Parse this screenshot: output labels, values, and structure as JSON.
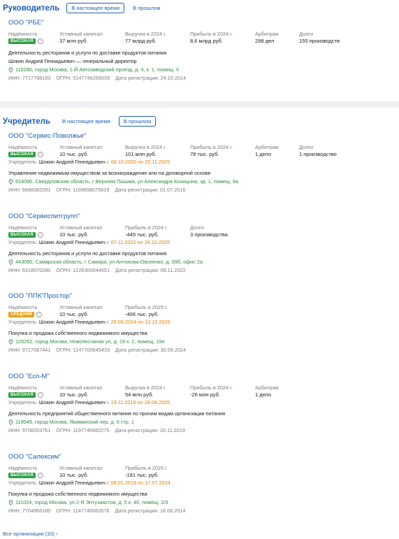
{
  "leader": {
    "title": "Руководитель",
    "tab_present": "В настоящее время",
    "tab_past": "В прошлом",
    "org": {
      "name": "ООО \"РБЕ\"",
      "labels": [
        "Надёжность",
        "Уставный капитал",
        "Выручка в 2024 г.",
        "Прибыль в 2024 г.",
        "Арбитраж",
        "Долги"
      ],
      "badge": "ВЫСОКАЯ",
      "values": [
        "37 млн руб.",
        "77 млрд руб.",
        "8,6 млрд руб.",
        "298 дел",
        "155 производств"
      ],
      "activity": "Деятельность ресторанов и услуги по доставке продуктов питания",
      "director": "Шокин Андрей Геннадьевич — генеральный директор",
      "address": "115280, город Москва, 1-Й Автозаводский проезд, д. 4, к. 1, помещ. II",
      "inn": "ИНН: 7717798160",
      "ogrn": "ОГРН: 5147746269039",
      "reg": "Дата регистрации: 24.10.2014"
    }
  },
  "founder": {
    "title": "Учредитель",
    "tab_present": "В настоящее время",
    "tab_past": "В прошлом",
    "founder_prefix": "Учредитель:",
    "founder_name": "Шокин Андрей Геннадьевич",
    "orgs": [
      {
        "name": "ООО \"Сервис-Поволжье\"",
        "labels": [
          "Надёжность",
          "Уставный капитал",
          "Выручка в 2024 г.",
          "Прибыль в 2024 г.",
          "Арбитраж",
          "Долги"
        ],
        "badge": "ВЫСОКАЯ",
        "values": [
          "10 тыс. руб.",
          "101 млн руб.",
          "78 тыс. руб.",
          "1 дело",
          "1 производство"
        ],
        "dates": "с 08.10.2020 по 25.11.2025",
        "activity": "Управление недвижимым имуществом за вознаграждение или на договорной основе",
        "address": "624090, Свердловская область, г Верхняя Пышма, ул Александра Козицына, зд. 1, помещ. 8а",
        "inn": "ИНН: 6686082291",
        "ogrn": "ОГРН: 1169658075619",
        "reg": "Дата регистрации: 01.07.2016"
      },
      {
        "name": "ООО \"Сервиспитгрупп\"",
        "labels": [
          "Надёжность",
          "Уставный капитал",
          "Прибыль в 2024 г.",
          "Долги"
        ],
        "badge": "ВЫСОКАЯ",
        "values": [
          "10 тыс. руб.",
          "-449 тыс. руб.",
          "3 производства"
        ],
        "dates": "с 07.11.2022 по 26.10.2025",
        "activity": "Деятельность ресторанов и услуги по доставке продуктов питания",
        "address": "443090, Самарская область, г Самара, ул Антонова-Овсеенко, д. 59б, офис 2а",
        "inn": "ИНН: 6318070280",
        "ogrn": "ОГРН: 1226300044651",
        "reg": "Дата регистрации: 08.11.2022"
      },
      {
        "name": "ООО \"ППК\"Простор\"",
        "labels": [
          "Надёжность",
          "Уставный капитал",
          "Прибыль в 2025 г."
        ],
        "badge": "СРЕДНЯЯ",
        "values": [
          "10 тыс. руб.",
          "-406 тыс. руб."
        ],
        "dates": "с 29.09.2024 по 13.10.2025",
        "activity": "Покупка и продажа собственного недвижимого имущества",
        "address": "125252, город Москва, Новопесчаная ул, д. 19 к. 2, помещ. 19п",
        "inn": "ИНН: 9727087441",
        "ogrn": "ОГРН: 1247700645433",
        "reg": "Дата регистрации: 30.09.2024"
      },
      {
        "name": "ООО \"Есп-М\"",
        "labels": [
          "Надёжность",
          "Уставный капитал",
          "Выручка в 2024 г.",
          "Прибыль в 2024 г.",
          "Арбитраж"
        ],
        "badge": "ВЫСОКАЯ",
        "values": [
          "10 тыс. руб.",
          "54 млн руб.",
          "-26 млн руб.",
          "1 дело"
        ],
        "dates": "с 19.11.2019 по 28.08.2025",
        "activity": "Деятельность предприятий общественного питания по прочим видам организации питания",
        "address": "119049, город Москва, Якиманский пер, д. 6 стр. 1",
        "inn": "ИНН: 9706003761",
        "ogrn": "ОГРН: 1197746682275",
        "reg": "Дата регистрации: 20.11.2019"
      },
      {
        "name": "ООО \"Салексим\"",
        "labels": [
          "Надёжность",
          "Уставный капитал",
          "Прибыль в 2025 г."
        ],
        "badge": "ВЫСОКАЯ",
        "values": [
          "10 тыс. руб.",
          "-181 тыс. руб."
        ],
        "dates": "с 09.01.2019 по 17.07.2024",
        "activity": "Покупка и продажа собственного недвижимого имущества",
        "address": "111024, город Москва, ул 2-Я Энтузиастов, д. 5 к. 40, помещ. 2/3",
        "inn": "ИНН: 7704866180",
        "ogrn": "ОГРН: 1147746682676",
        "reg": "Дата регистрации: 16.06.2014"
      }
    ],
    "all_link": "Все организации (33)"
  },
  "colors": {
    "link": "#1a5fb4",
    "high": "#2e9e44",
    "medium": "#e6a116",
    "dates": "#e07b00",
    "address": "#2e8b3e"
  },
  "icons": [
    "info-icon",
    "location-pin-icon",
    "chevron-right-icon"
  ]
}
